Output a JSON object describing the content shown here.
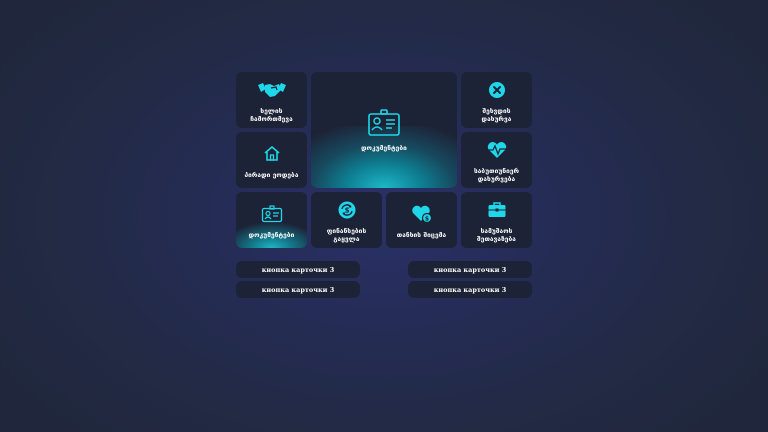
{
  "colors": {
    "accent": "#1fd7e8",
    "tile_bg": "#1d2337"
  },
  "tiles": [
    {
      "label": "ხელის\nჩამორთმევა",
      "icon": "handshake-icon"
    },
    {
      "label": "დოკუმენტები",
      "icon": "id-card-icon"
    },
    {
      "label": "შეხვდის\nდახურვა",
      "icon": "close-circle-icon"
    },
    {
      "label": "პირადი ეოდება",
      "icon": "home-icon"
    },
    {
      "label": "საბუთიუნიერ\nდახურვება",
      "icon": "heart-pulse-icon"
    },
    {
      "label": "დოკუმენტები",
      "icon": "id-card-small-icon"
    },
    {
      "label": "ფინანსების\nგაყვლა",
      "icon": "refresh-dollar-icon"
    },
    {
      "label": "თანხის შიცემა",
      "icon": "heart-hand-icon"
    },
    {
      "label": "სამუშაოს\nშეთავაზება",
      "icon": "briefcase-icon"
    }
  ],
  "chips": [
    {
      "label": "кнопка карточки 3"
    },
    {
      "label": "кнопка карточки 3"
    },
    {
      "label": "кнопка карточки 3"
    },
    {
      "label": "кнопка карточки 3"
    }
  ]
}
